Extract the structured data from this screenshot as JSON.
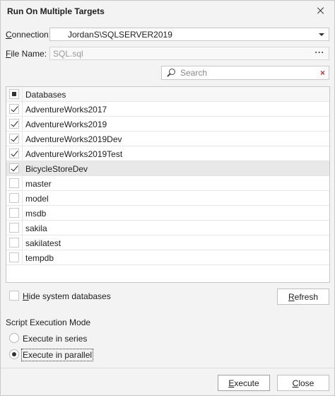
{
  "window": {
    "title": "Run On Multiple Targets"
  },
  "connection": {
    "label_prefix": "C",
    "label_rest": "onnection:",
    "value": "JordanS\\SQLSERVER2019"
  },
  "file": {
    "label_prefix": "F",
    "label_rest": "ile Name:",
    "value": "SQL.sql",
    "browse": "···"
  },
  "search": {
    "placeholder": "Search",
    "clear": "×"
  },
  "list": {
    "header": "Databases",
    "items": [
      {
        "name": "AdventureWorks2017",
        "checked": true
      },
      {
        "name": "AdventureWorks2019",
        "checked": true
      },
      {
        "name": "AdventureWorks2019Dev",
        "checked": true
      },
      {
        "name": "AdventureWorks2019Test",
        "checked": true
      },
      {
        "name": "BicycleStoreDev",
        "checked": true
      },
      {
        "name": "master",
        "checked": false
      },
      {
        "name": "model",
        "checked": false
      },
      {
        "name": "msdb",
        "checked": false
      },
      {
        "name": "sakila",
        "checked": false
      },
      {
        "name": "sakilatest",
        "checked": false
      },
      {
        "name": "tempdb",
        "checked": false
      }
    ]
  },
  "hide_system": {
    "label_prefix": "H",
    "label_rest": "ide system databases",
    "checked": false
  },
  "refresh": {
    "label_prefix": "R",
    "label_rest": "efresh"
  },
  "mode": {
    "title": "Script Execution Mode",
    "series_label": "Execute in series",
    "parallel_label": "Execute in parallel",
    "selected": "parallel"
  },
  "execute": {
    "label_prefix": "E",
    "label_rest": "xecute"
  },
  "close": {
    "label_prefix": "C",
    "label_rest": "lose"
  }
}
